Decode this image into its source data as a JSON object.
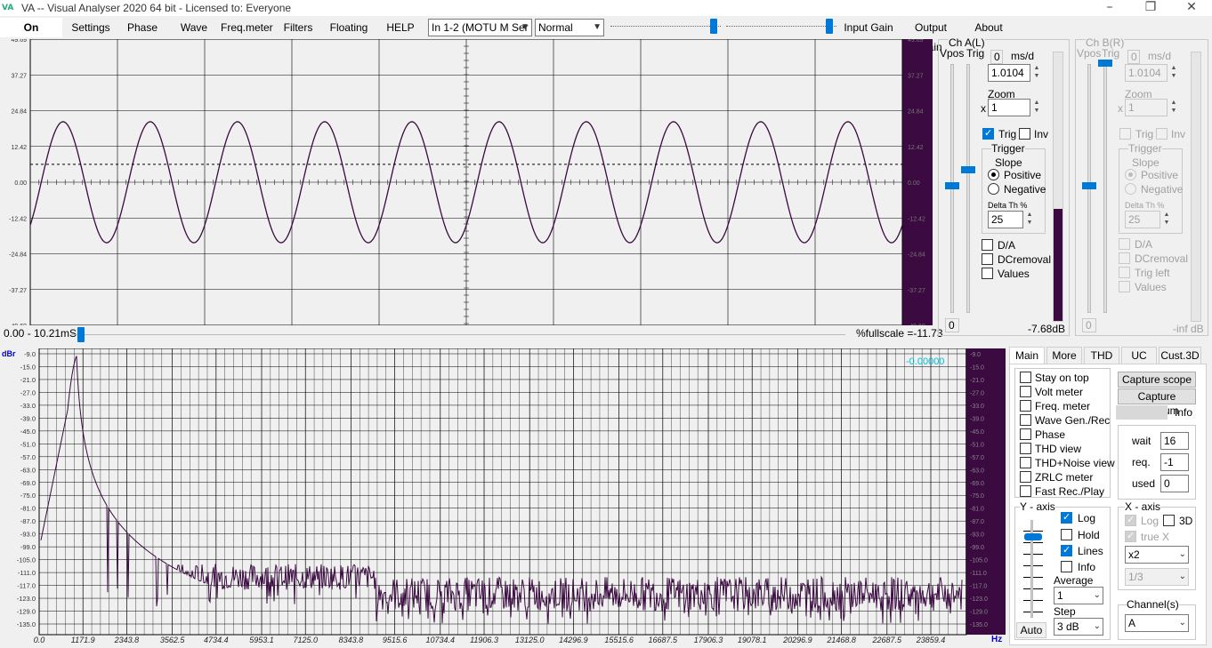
{
  "window": {
    "logo": "VA",
    "title": "VA -- Visual Analyser 2020 64 bit - Licensed to: Everyone"
  },
  "menu": {
    "on": "On",
    "settings": "Settings",
    "phase": "Phase",
    "wave": "Wave",
    "freqmeter": "Freq.meter",
    "filters": "Filters",
    "floating": "Floating",
    "help": "HELP",
    "input_device": "In 1-2 (MOTU M Ser",
    "mode": "Normal",
    "input_gain": "Input Gain",
    "output_gain": "Output Gain",
    "about": "About"
  },
  "scope": {
    "y_ticks": [
      "49.69",
      "37.27",
      "24.84",
      "12.42",
      "0.00",
      "-12.42",
      "-24.84",
      "-37.27",
      "-49.69"
    ],
    "time_range": "0.00 - 10.21mS",
    "fullscale": "%fullscale =-11.73",
    "cycles": 10,
    "amplitude": 21,
    "trigger_level": 6.2
  },
  "chA": {
    "title": "Ch A(L)",
    "vpos": "Vpos",
    "trig": "Trig",
    "zero": "0",
    "msd_label": "ms/d",
    "msd": "1.0104",
    "zoom_label": "Zoom",
    "x": "x",
    "zoom": "1",
    "trig_cb": "Trig",
    "inv_cb": "Inv",
    "trigger": "Trigger",
    "slope": "Slope",
    "positive": "Positive",
    "negative": "Negative",
    "delta": "Delta Th %",
    "delta_val": "25",
    "da": "D/A",
    "dcremoval": "DCremoval",
    "values": "Values",
    "bottom_zero": "0",
    "db": "-7.68dB"
  },
  "chB": {
    "title": "Ch B(R)",
    "vpos": "Vpos",
    "trig": "Trig",
    "zero": "0",
    "msd_label": "ms/d",
    "msd": "1.0104",
    "zoom_label": "Zoom",
    "x": "x",
    "zoom": "1",
    "trig_cb": "Trig",
    "inv_cb": "Inv",
    "trigger": "Trigger",
    "slope": "Slope",
    "positive": "Positive",
    "negative": "Negative",
    "delta": "Delta Th %",
    "delta_val": "25",
    "da": "D/A",
    "dcremoval": "DCremoval",
    "trigleft": "Trig left",
    "values": "Values",
    "bottom_zero": "0",
    "db": "-inf dB"
  },
  "spectrum": {
    "unit_y": "dBr",
    "unit_x": "Hz",
    "readout": "-0.00000",
    "y_ticks": [
      "-9.0",
      "-15.0",
      "-21.0",
      "-27.0",
      "-33.0",
      "-39.0",
      "-45.0",
      "-51.0",
      "-57.0",
      "-63.0",
      "-69.0",
      "-75.0",
      "-81.0",
      "-87.0",
      "-93.0",
      "-99.0",
      "-105.0",
      "-111.0",
      "-117.0",
      "-123.0",
      "-129.0",
      "-135.0"
    ],
    "x_ticks": [
      "0.0",
      "1171.9",
      "2343.8",
      "3562.5",
      "4734.4",
      "5953.1",
      "7125.0",
      "8343.8",
      "9515.6",
      "10734.4",
      "11906.3",
      "13125.0",
      "14296.9",
      "15515.6",
      "16687.5",
      "17906.3",
      "19078.1",
      "20296.9",
      "21468.8",
      "22687.5",
      "23859.4"
    ]
  },
  "tabs": [
    "Main",
    "More",
    "THD",
    "UC",
    "Cust.3D"
  ],
  "main_panel": {
    "options": [
      "Stay on top",
      "Volt meter",
      "Freq. meter",
      "Wave Gen./Rec",
      "Phase",
      "THD view",
      "THD+Noise view",
      "ZRLC meter",
      "Fast Rec./Play"
    ],
    "capture_scope": "Capture scope",
    "capture_spectrum": "Capture spectrum",
    "info": "Info",
    "wait_label": "wait",
    "wait": "16",
    "req_label": "req.",
    "req": "-1",
    "used_label": "used",
    "used": "0",
    "yaxis": "Y - axis",
    "log": "Log",
    "hold": "Hold",
    "lines": "Lines",
    "yinfo": "Info",
    "average": "Average",
    "average_val": "1",
    "step": "Step",
    "step_val": "3 dB",
    "auto": "Auto",
    "xaxis": "X - axis",
    "xlog": "Log",
    "x3d": "3D",
    "truex": "true X",
    "xmult": "x2",
    "octave": "1/3",
    "channels": "Channel(s)",
    "channel_val": "A"
  }
}
